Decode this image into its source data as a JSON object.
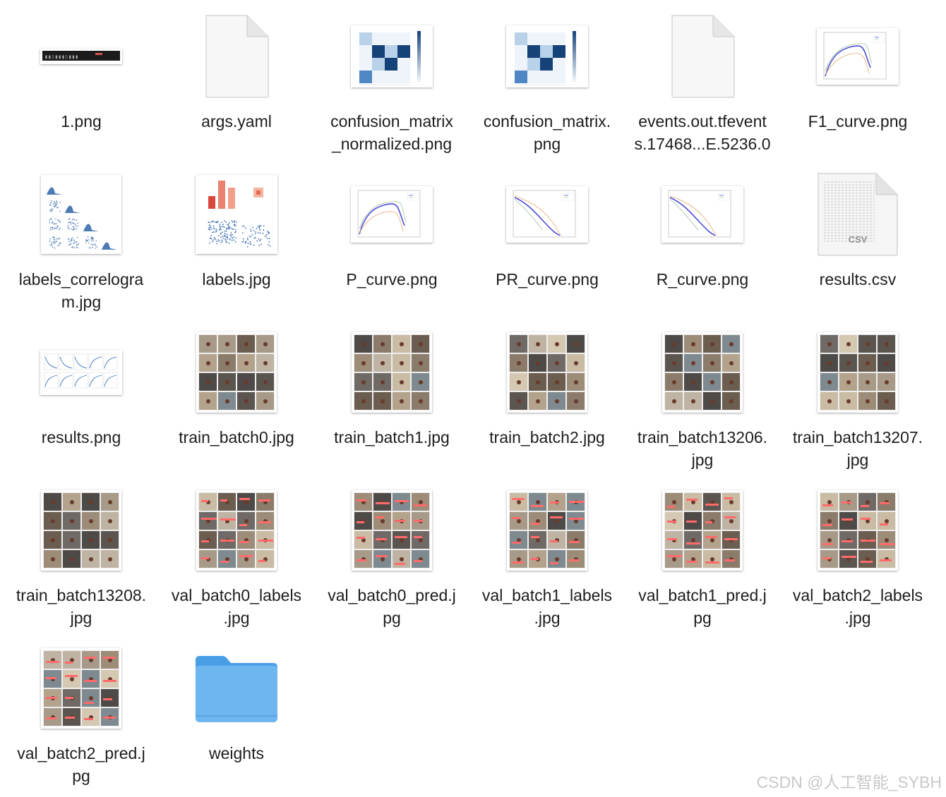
{
  "files": [
    {
      "name": "1.png",
      "kind": "wide-image",
      "icon": "png-thumbnail-icon"
    },
    {
      "name": "args.yaml",
      "kind": "doc",
      "icon": "document-icon"
    },
    {
      "name": "confusion_matrix\n_normalized.png",
      "kind": "matrix",
      "icon": "confusion-matrix-thumbnail-icon"
    },
    {
      "name": "confusion_matrix.\npng",
      "kind": "matrix",
      "icon": "confusion-matrix-thumbnail-icon"
    },
    {
      "name": "events.out.tfevent\ns.17468...E.5236.0",
      "kind": "doc",
      "icon": "document-icon"
    },
    {
      "name": "F1_curve.png",
      "kind": "curve",
      "icon": "curve-plot-thumbnail-icon"
    },
    {
      "name": "labels_correlogra\nm.jpg",
      "kind": "correlogram",
      "icon": "correlogram-thumbnail-icon"
    },
    {
      "name": "labels.jpg",
      "kind": "labels",
      "icon": "labels-plot-thumbnail-icon"
    },
    {
      "name": "P_curve.png",
      "kind": "curve",
      "icon": "curve-plot-thumbnail-icon"
    },
    {
      "name": "PR_curve.png",
      "kind": "curve-down",
      "icon": "curve-plot-thumbnail-icon"
    },
    {
      "name": "R_curve.png",
      "kind": "curve-down",
      "icon": "curve-plot-thumbnail-icon"
    },
    {
      "name": "results.csv",
      "kind": "csv",
      "icon": "csv-document-icon",
      "badge": "CSV"
    },
    {
      "name": "results.png",
      "kind": "results",
      "icon": "results-plot-thumbnail-icon"
    },
    {
      "name": "train_batch0.jpg",
      "kind": "mosaic",
      "icon": "image-mosaic-thumbnail-icon"
    },
    {
      "name": "train_batch1.jpg",
      "kind": "mosaic",
      "icon": "image-mosaic-thumbnail-icon"
    },
    {
      "name": "train_batch2.jpg",
      "kind": "mosaic",
      "icon": "image-mosaic-thumbnail-icon"
    },
    {
      "name": "train_batch13206.\njpg",
      "kind": "mosaic",
      "icon": "image-mosaic-thumbnail-icon"
    },
    {
      "name": "train_batch13207.\njpg",
      "kind": "mosaic",
      "icon": "image-mosaic-thumbnail-icon"
    },
    {
      "name": "train_batch13208.\njpg",
      "kind": "mosaic",
      "icon": "image-mosaic-thumbnail-icon"
    },
    {
      "name": "val_batch0_labels\n.jpg",
      "kind": "mosaic-labeled",
      "icon": "image-mosaic-thumbnail-icon"
    },
    {
      "name": "val_batch0_pred.j\npg",
      "kind": "mosaic-labeled",
      "icon": "image-mosaic-thumbnail-icon"
    },
    {
      "name": "val_batch1_labels\n.jpg",
      "kind": "mosaic-labeled",
      "icon": "image-mosaic-thumbnail-icon"
    },
    {
      "name": "val_batch1_pred.j\npg",
      "kind": "mosaic-labeled",
      "icon": "image-mosaic-thumbnail-icon"
    },
    {
      "name": "val_batch2_labels\n.jpg",
      "kind": "mosaic-labeled",
      "icon": "image-mosaic-thumbnail-icon"
    },
    {
      "name": "val_batch2_pred.j\npg",
      "kind": "mosaic-labeled",
      "icon": "image-mosaic-thumbnail-icon"
    },
    {
      "name": "weights",
      "kind": "folder",
      "icon": "folder-icon"
    }
  ],
  "watermark": "CSDN @人工智能_SYBH",
  "colors": {
    "folder": "#6db6f0",
    "folder_tab": "#4a9ee6",
    "matrix_dark": "#16427a",
    "matrix_mid": "#4f86c4",
    "matrix_light": "#b9d2ea"
  }
}
